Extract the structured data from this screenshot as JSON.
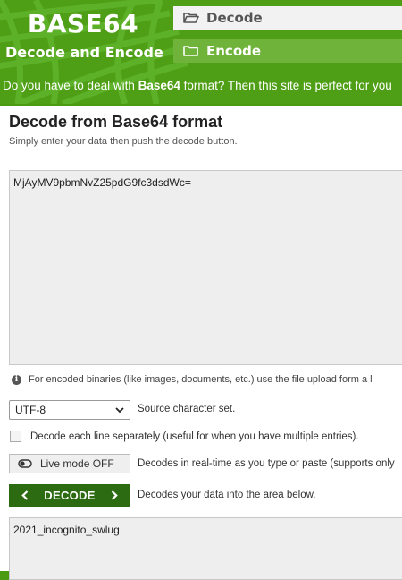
{
  "header": {
    "logo_title": "BASE64",
    "logo_subtitle": "Decode and Encode",
    "nav": [
      {
        "label": "Decode",
        "icon": "folder-open-icon",
        "active": true
      },
      {
        "label": "Encode",
        "icon": "folder-icon",
        "active": false
      }
    ],
    "tagline_pre": "Do you have to deal with ",
    "tagline_bold": "Base64",
    "tagline_post": " format? Then this site is perfect for you"
  },
  "main": {
    "title": "Decode from Base64 format",
    "subtitle": "Simply enter your data then push the decode button.",
    "input_value": "MjAyMV9pbmNvZ25pdG9fc3dsdWc=",
    "info_text": "For encoded binaries (like images, documents, etc.) use the file upload form a l",
    "charset": {
      "selected": "UTF-8",
      "label": "Source character set."
    },
    "each_line": {
      "checked": false,
      "label": "Decode each line separately (useful for when you have multiple entries)."
    },
    "live_mode": {
      "button_label": "Live mode OFF",
      "description": "Decodes in real-time as you type or paste (supports only"
    },
    "decode": {
      "button_label": "DECODE",
      "description": "Decodes your data into the area below."
    },
    "output_value": "2021_incognito_swlug"
  },
  "colors": {
    "brand_green": "#4f9f16",
    "button_green": "#2d6b12",
    "field_bg": "#eeeeee"
  }
}
